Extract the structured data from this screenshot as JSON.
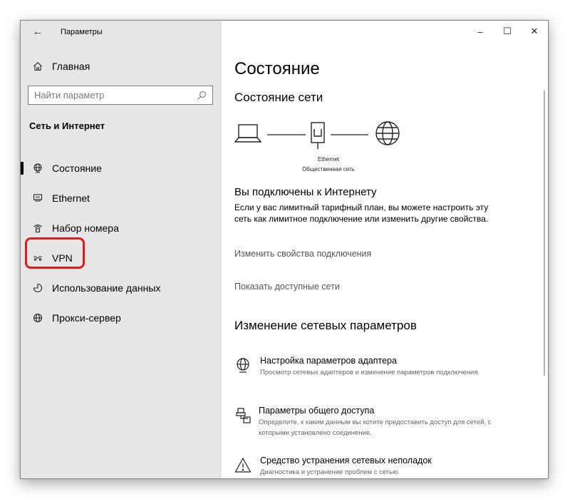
{
  "window": {
    "title": "Параметры",
    "controls": {
      "minimize": "–",
      "maximize": "☐",
      "close": "✕"
    }
  },
  "sidebar": {
    "home_label": "Главная",
    "search_placeholder": "Найти параметр",
    "section_title": "Сеть и Интернет",
    "items": [
      {
        "label": "Состояние",
        "icon": "globe-network-icon",
        "active": true
      },
      {
        "label": "Ethernet",
        "icon": "ethernet-icon",
        "active": false
      },
      {
        "label": "Набор номера",
        "icon": "dialup-icon",
        "active": false
      },
      {
        "label": "VPN",
        "icon": "vpn-icon",
        "active": false,
        "highlighted": true
      },
      {
        "label": "Использование данных",
        "icon": "data-usage-icon",
        "active": false
      },
      {
        "label": "Прокси-сервер",
        "icon": "globe-icon",
        "active": false
      }
    ]
  },
  "main": {
    "heading": "Состояние",
    "network_status_heading": "Состояние сети",
    "diagram": {
      "adapter_name": "Ethernet",
      "network_type": "Общественная сеть"
    },
    "connected_title": "Вы подключены к Интернету",
    "connected_text": "Если у вас лимитный тарифный план, вы можете настроить эту сеть как лимитное подключение или изменить другие свойства.",
    "link_change_properties": "Изменить свойства подключения",
    "link_show_networks": "Показать доступные сети",
    "change_settings_heading": "Изменение сетевых параметров",
    "options": [
      {
        "title": "Настройка параметров адаптера",
        "desc": "Просмотр сетевых адаптеров и изменение параметров подключения.",
        "icon": "adapter-icon"
      },
      {
        "title": "Параметры общего доступа",
        "desc": "Определите, к каким данным вы хотите предоставить доступ для сетей, с которыми установлено соединение.",
        "icon": "sharing-icon"
      },
      {
        "title": "Средство устранения сетевых неполадок",
        "desc": "Диагностика и устранение проблем с сетью.",
        "icon": "warning-icon"
      }
    ]
  },
  "colors": {
    "sidebar_bg": "#e6e6e6",
    "highlight": "#e11a1a",
    "link": "#555555"
  }
}
